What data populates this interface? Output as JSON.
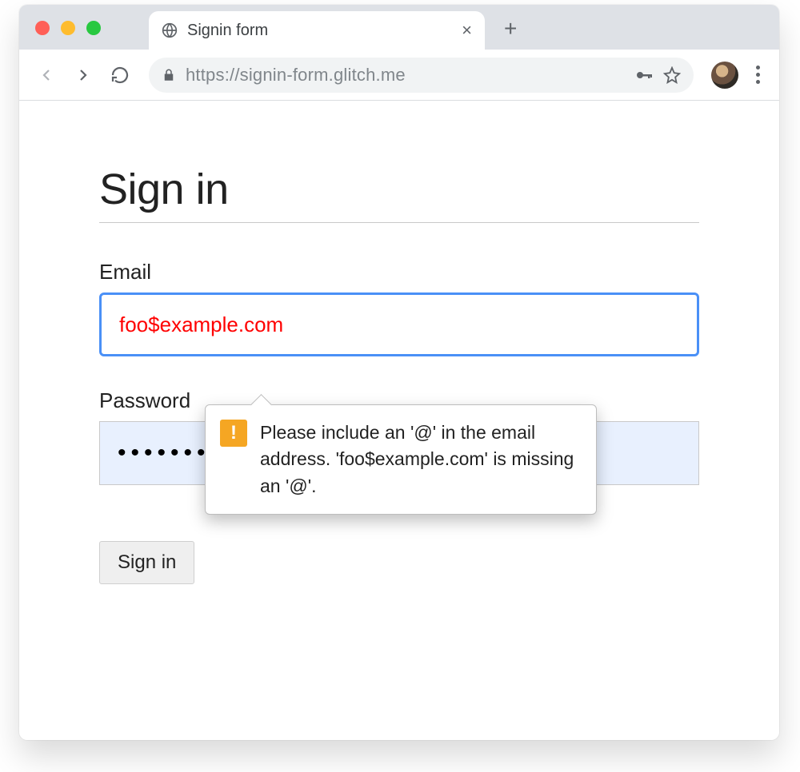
{
  "browser": {
    "tab_title": "Signin form",
    "url": "https://signin-form.glitch.me",
    "newtab_symbol": "+",
    "close_symbol": "×"
  },
  "page": {
    "heading": "Sign in",
    "email_label": "Email",
    "email_value": "foo$example.com",
    "password_label": "Password",
    "password_value": "••••••••••",
    "submit_label": "Sign in"
  },
  "validation": {
    "message": "Please include an '@' in the email address. 'foo$example.com' is missing an '@'."
  }
}
